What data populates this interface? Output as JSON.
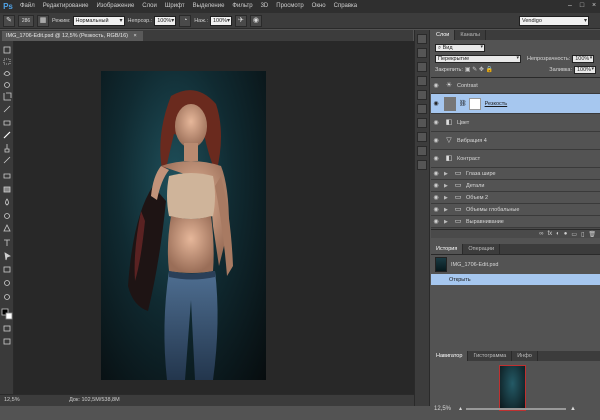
{
  "menubar": {
    "logo": "Ps",
    "items": [
      "Файл",
      "Редактирование",
      "Изображение",
      "Слои",
      "Шрифт",
      "Выделение",
      "Фильтр",
      "3D",
      "Просмотр",
      "Окно",
      "Справка"
    ],
    "controls": [
      "–",
      "□",
      "×"
    ]
  },
  "options": {
    "brush_size": "286",
    "mode_label": "Режим:",
    "mode_value": "Нормальный",
    "opacity_label": "Непрозр.:",
    "opacity_value": "100%",
    "press_label": "Наж.:",
    "press_value": "100%",
    "workspace": "Vendigo"
  },
  "document": {
    "tab_title": "IMG_1706-Edit.psd @ 12,5% (Резкость, RGB/16)",
    "close": "×"
  },
  "status": {
    "zoom": "12,5%",
    "doc_info": "Док: 102,5M/538,8M"
  },
  "layers_panel": {
    "tabs": [
      "Слои",
      "Каналы"
    ],
    "filter_label": "Вид",
    "blend_mode": "Перекрытие",
    "opacity_label": "Непрозрачность:",
    "opacity_value": "100%",
    "lock_label": "Закрепить:",
    "fill_label": "Заливка:",
    "fill_value": "100%",
    "layers": [
      {
        "name": "Contrast",
        "icon": "sun-icon",
        "type": "tall"
      },
      {
        "name": "Резкость",
        "icon": "layer-icon",
        "type": "selected"
      },
      {
        "name": "Цвет",
        "icon": "adjustment-icon",
        "type": "tall"
      },
      {
        "name": "Вибрация 4",
        "icon": "triangle-icon",
        "type": "tall"
      },
      {
        "name": "Контраст",
        "icon": "adjustment-icon",
        "type": "tall"
      },
      {
        "name": "Глаза шире",
        "icon": "folder-icon",
        "type": "group"
      },
      {
        "name": "Детали",
        "icon": "folder-icon",
        "type": "group"
      },
      {
        "name": "Объем 2",
        "icon": "folder-icon",
        "type": "group"
      },
      {
        "name": "Объемы глобальные",
        "icon": "folder-icon",
        "type": "group"
      },
      {
        "name": "Выравнивание",
        "icon": "folder-icon",
        "type": "group"
      }
    ],
    "footer_icons": [
      "∞",
      "fx",
      "◐",
      "●",
      "▭",
      "▯",
      "🗑"
    ]
  },
  "history_panel": {
    "tabs": [
      "История",
      "Операции"
    ],
    "doc_name": "IMG_1706-Edit.psd",
    "state": "Открыть"
  },
  "navigator_panel": {
    "tabs": [
      "Навигатор",
      "Гистограмма",
      "Инфо"
    ],
    "zoom": "12,5%"
  },
  "colors": {
    "selected": "#a6c7ef",
    "panel": "#535353",
    "canvas": "#282828"
  }
}
